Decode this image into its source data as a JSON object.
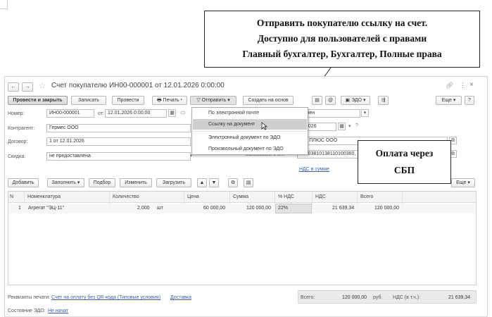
{
  "callouts": {
    "send_link": {
      "line1": "Отправить покупателю ссылку на счет.",
      "line2": "Доступно для пользователей с правами",
      "line3": "Главный бухгалтер, Бухгалтер, Полные права"
    },
    "sbp": {
      "line1": "Оплата через",
      "line2": "СБП"
    }
  },
  "window": {
    "title": "Счет покупателю ИН00-000001 от 12.01.2026 0:00:00",
    "icons": {
      "back": "arrow-left",
      "forward": "arrow-right",
      "star": "star",
      "link": "link",
      "more": "more-vertical",
      "close": "close"
    }
  },
  "toolbar": {
    "post_close": "Провести и закрыть",
    "save": "Записать",
    "post": "Провести",
    "print": "Печать",
    "send": "Отправить",
    "create_based": "Создать на основ",
    "edo": "ЭДО",
    "more": "Еще",
    "help": "?"
  },
  "send_menu": {
    "items": [
      "По электронной почте",
      "Ссылку на документ",
      "Электронный документ по ЭДО",
      "Произвольный документ по ЭДО"
    ],
    "active_index": 1
  },
  "form": {
    "number_label": "Номер:",
    "number_value": "ИН00-000001",
    "date_label": "от:",
    "date_value": "12.01.2026  0:00:00",
    "contractor_label": "Контрагент:",
    "contractor_value": "Гермес ООО",
    "contract_label": "Договор:",
    "contract_value": "1 от 12.01.2026",
    "discount_label": "Скидка:",
    "discount_value": "не предоставлена",
    "status_value": "ачен",
    "pay_date_value": ".2026",
    "org_value": "ОМ ПЛЮС ООО",
    "bank_label": "Банковский счет:",
    "bank_value": "40703810138110100360, ...",
    "vat_link": "НДС в сумме"
  },
  "table_toolbar": {
    "add": "Добавить",
    "fill": "Заполнить",
    "select": "Подбор",
    "change": "Изменить",
    "upload": "Загрузить",
    "more": "Еще"
  },
  "table": {
    "headers": [
      "N",
      "Номенклатура",
      "Количество",
      "Цена",
      "Сумма",
      "% НДС",
      "НДС",
      "Всего"
    ],
    "rows": [
      {
        "n": "1",
        "item": "Агрегат \"ЭЦ-11\"",
        "qty": "2,000",
        "unit": "шт",
        "price": "60 000,00",
        "sum": "120 000,00",
        "vat_rate": "22%",
        "vat": "21 639,34",
        "total": "120 000,00"
      }
    ]
  },
  "footer": {
    "print_requisites_label": "Реквизиты печати:",
    "print_requisites_link": "Счет на оплату без QR-кода (Типовые условия)",
    "delivery_link": "Доставка",
    "edo_state_label": "Состояние ЭДО:",
    "edo_state_link": "Не начат",
    "total_label": "Всего:",
    "total_value": "120 000,00",
    "currency": "руб.",
    "vat_label": "НДС (в т.ч.):",
    "vat_value": "21 639,34"
  }
}
